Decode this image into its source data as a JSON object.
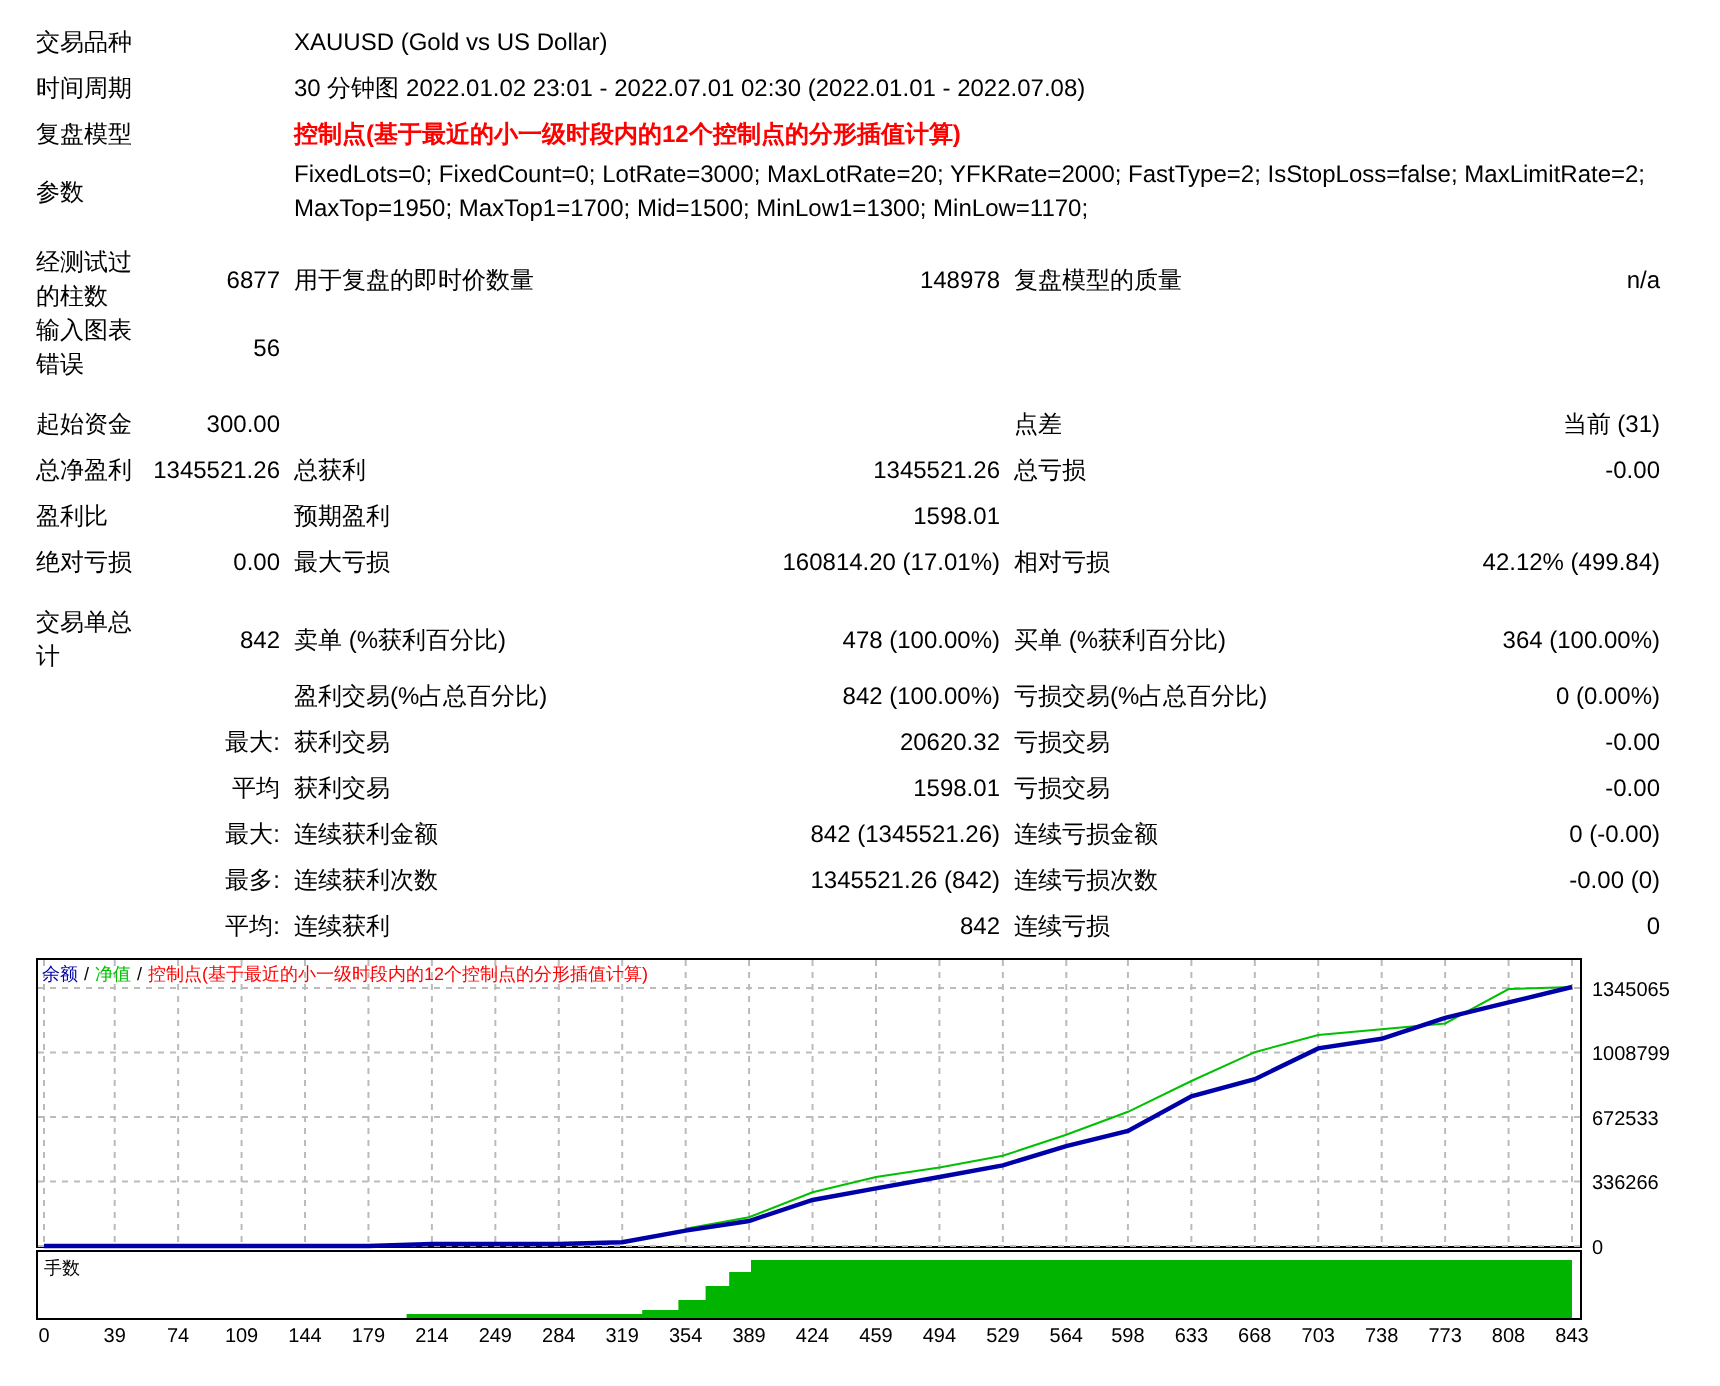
{
  "summary": [
    {
      "label": "交易品种",
      "value": "XAUUSD (Gold vs US Dollar)",
      "kind": "plain"
    },
    {
      "label": "时间周期",
      "value": "30 分钟图 2022.01.02 23:01 - 2022.07.01 02:30 (2022.01.01 - 2022.07.08)",
      "kind": "plain"
    },
    {
      "label": "复盘模型",
      "value": "控制点(基于最近的小一级时段内的12个控制点的分形插值计算)",
      "kind": "highlight"
    },
    {
      "label": "参数",
      "value": "FixedLots=0; FixedCount=0; LotRate=3000; MaxLotRate=20; YFKRate=2000; FastType=2; IsStopLoss=false; MaxLimitRate=2; MaxTop=1950; MaxTop1=1700; Mid=1500; MinLow1=1300; MinLow=1170;",
      "kind": "plain"
    }
  ],
  "sections": [
    {
      "rows": [
        {
          "label": "经测试过的柱数",
          "value": "6877",
          "label_2": "用于复盘的即时价数量",
          "value_2": "148978",
          "label_3": "复盘模型的质量",
          "value_3": "n/a"
        },
        {
          "label": "输入图表错误",
          "value": "56"
        }
      ]
    },
    {
      "rows": [
        {
          "label": "起始资金",
          "value": "300.00",
          "label_3": "点差",
          "value_3": "当前 (31)"
        },
        {
          "label": "总净盈利",
          "value": "1345521.26",
          "label_2": "总获利",
          "value_2": "1345521.26",
          "label_3": "总亏损",
          "value_3": "-0.00"
        },
        {
          "label": "盈利比",
          "label_2": "预期盈利",
          "value_2": "1598.01"
        },
        {
          "label": "绝对亏损",
          "value": "0.00",
          "label_2": "最大亏损",
          "value_2": "160814.20 (17.01%)",
          "label_3": "相对亏损",
          "value_3": "42.12% (499.84)"
        }
      ]
    },
    {
      "rows": [
        {
          "label": "交易单总计",
          "value": "842",
          "label_2": "卖单 (%获利百分比)",
          "value_2": "478 (100.00%)",
          "label_3": "买单 (%获利百分比)",
          "value_3": "364 (100.00%)"
        },
        {
          "label_2": "盈利交易(%占总百分比)",
          "value_2": "842 (100.00%)",
          "label_3": "亏损交易(%占总百分比)",
          "value_3": "0 (0.00%)"
        },
        {
          "value": "最大:",
          "label_2": "获利交易",
          "value_2": "20620.32",
          "label_3": "亏损交易",
          "value_3": "-0.00"
        },
        {
          "value": "平均",
          "label_2": "获利交易",
          "value_2": "1598.01",
          "label_3": "亏损交易",
          "value_3": "-0.00"
        },
        {
          "value": "最大:",
          "label_2": "连续获利金额",
          "value_2": "842 (1345521.26)",
          "label_3": "连续亏损金额",
          "value_3": "0 (-0.00)"
        },
        {
          "value": "最多:",
          "label_2": "连续获利次数",
          "value_2": "1345521.26 (842)",
          "label_3": "连续亏损次数",
          "value_3": "-0.00 (0)"
        },
        {
          "value": "平均:",
          "label_2": "连续获利",
          "value_2": "842",
          "label_3": "连续亏损",
          "value_3": "0"
        }
      ]
    }
  ],
  "chart": {
    "legend_separators": [
      "/",
      "/"
    ],
    "legend_note": "控制点(基于最近的小一级时段内的12个控制点的分形插值计算)",
    "lots_label": "手数",
    "chart_data": {
      "type": "line",
      "x": [
        0,
        39,
        74,
        109,
        144,
        179,
        214,
        249,
        284,
        319,
        354,
        389,
        424,
        459,
        494,
        529,
        564,
        598,
        633,
        668,
        703,
        738,
        773,
        808,
        843
      ],
      "series": [
        {
          "name": "余额",
          "color": "#0000a8",
          "values": [
            0,
            0,
            0,
            0,
            0,
            0,
            10000,
            10000,
            10000,
            20000,
            80000,
            130000,
            240000,
            300000,
            360000,
            420000,
            520000,
            600000,
            780000,
            870000,
            1030000,
            1080000,
            1190000,
            1270000,
            1350000
          ]
        },
        {
          "name": "净值",
          "color": "#00c000",
          "values": [
            null,
            null,
            null,
            null,
            null,
            null,
            null,
            null,
            null,
            null,
            90000,
            150000,
            280000,
            360000,
            410000,
            470000,
            580000,
            700000,
            860000,
            1010000,
            1100000,
            1130000,
            1160000,
            1340000,
            1350000
          ]
        }
      ],
      "grid": true,
      "xlim": [
        0,
        843
      ],
      "ylim": [
        0,
        1491000
      ],
      "xticks": [
        0,
        39,
        74,
        109,
        144,
        179,
        214,
        249,
        284,
        319,
        354,
        389,
        424,
        459,
        494,
        529,
        564,
        598,
        633,
        668,
        703,
        738,
        773,
        808,
        843
      ],
      "yticks": [
        0,
        336266,
        672533,
        1008799,
        1345065
      ]
    }
  }
}
